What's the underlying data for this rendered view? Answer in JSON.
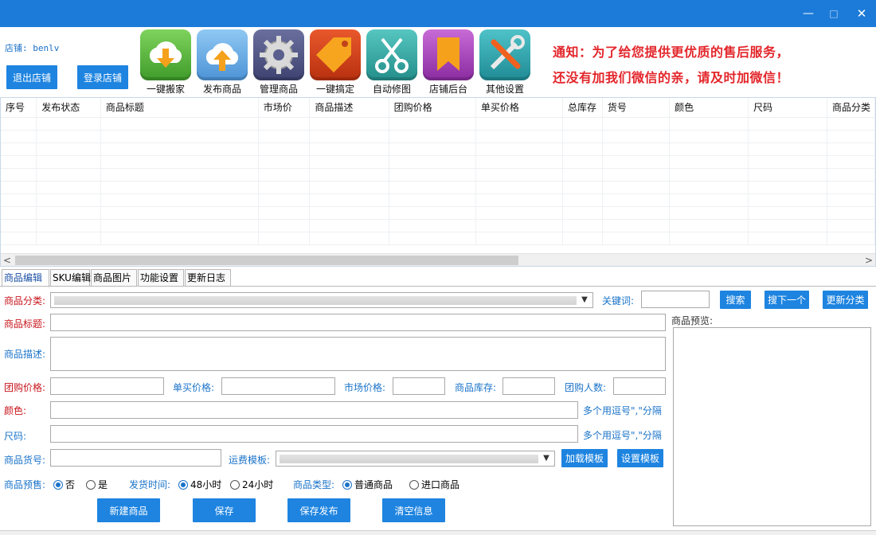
{
  "window": {
    "minimize": "—",
    "maximize": "□",
    "close": "✕"
  },
  "header": {
    "store_label": "店铺: benlv",
    "logout_button": "退出店铺",
    "login_button": "登录店铺",
    "tools": [
      {
        "label": "一键搬家",
        "icon": "download-cloud-icon"
      },
      {
        "label": "发布商品",
        "icon": "upload-cloud-icon"
      },
      {
        "label": "管理商品",
        "icon": "gear-icon"
      },
      {
        "label": "一键搞定",
        "icon": "tag-icon"
      },
      {
        "label": "自动修图",
        "icon": "scissors-icon"
      },
      {
        "label": "店铺后台",
        "icon": "bookmark-icon"
      },
      {
        "label": "其他设置",
        "icon": "tools-icon"
      }
    ],
    "notice_line1": "通知：为了给您提供更优质的售后服务，",
    "notice_line2": "还没有加我们微信的亲，请及时加微信！"
  },
  "grid": {
    "columns": [
      "序号",
      "发布状态",
      "商品标题",
      "市场价",
      "商品描述",
      "团购价格",
      "单买价格",
      "总库存",
      "货号",
      "颜色",
      "尺码",
      "商品分类"
    ]
  },
  "tabs": [
    "商品编辑",
    "SKU编辑",
    "商品图片",
    "功能设置",
    "更新日志"
  ],
  "form": {
    "category_label": "商品分类:",
    "keyword_label": "关键词:",
    "search_button": "搜索",
    "search_next_button": "搜下一个",
    "update_category_button": "更新分类",
    "title_label": "商品标题:",
    "preview_label": "商品预览:",
    "desc_label": "商品描述:",
    "group_price_label": "团购价格:",
    "single_price_label": "单买价格:",
    "market_price_label": "市场价格:",
    "stock_label": "商品库存:",
    "group_size_label": "团购人数:",
    "color_label": "颜色:",
    "color_hint": "多个用逗号\",\"分隔",
    "size_label": "尺码:",
    "size_hint": "多个用逗号\",\"分隔",
    "sku_label": "商品货号:",
    "shipping_template_label": "运费模板:",
    "load_template_button": "加载模板",
    "set_template_button": "设置模板",
    "presale_label": "商品预售:",
    "presale_no": "否",
    "presale_yes": "是",
    "ship_time_label": "发货时间:",
    "ship_48": "48小时",
    "ship_24": "24小时",
    "type_label": "商品类型:",
    "type_normal": "普通商品",
    "type_import": "进口商品",
    "new_button": "新建商品",
    "save_button": "保存",
    "save_publish_button": "保存发布",
    "clear_button": "清空信息"
  },
  "colors": {
    "titlebar": "#1c7bd8",
    "button": "#1e84e0",
    "notice": "#e3262b",
    "required_label": "#c8161d",
    "optional_label": "#1a73c9"
  }
}
